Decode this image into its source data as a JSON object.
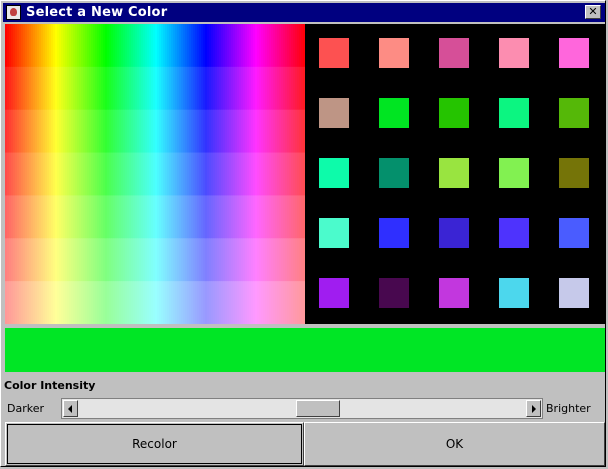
{
  "window": {
    "title": "Select a New Color"
  },
  "swatches": [
    [
      "#fd5151",
      "#fd8c84",
      "#d64f98",
      "#fc8db0",
      "#ff66dc"
    ],
    [
      "#be9585",
      "#00e522",
      "#25c400",
      "#0cf581",
      "#55b808"
    ],
    [
      "#0dfbaa",
      "#04906c",
      "#99e440",
      "#82f151",
      "#757408"
    ],
    [
      "#4bfbcc",
      "#2f2fff",
      "#3a24d4",
      "#4e33fd",
      "#4a5cff"
    ],
    [
      "#a01df0",
      "#48084f",
      "#c237de",
      "#4cd7ed",
      "#c6c9ea"
    ]
  ],
  "preview_color": "#00e625",
  "intensity": {
    "label": "Color Intensity",
    "darker": "Darker",
    "brighter": "Brighter",
    "level": 0.54
  },
  "buttons": {
    "recolor": "Recolor",
    "ok": "OK"
  }
}
